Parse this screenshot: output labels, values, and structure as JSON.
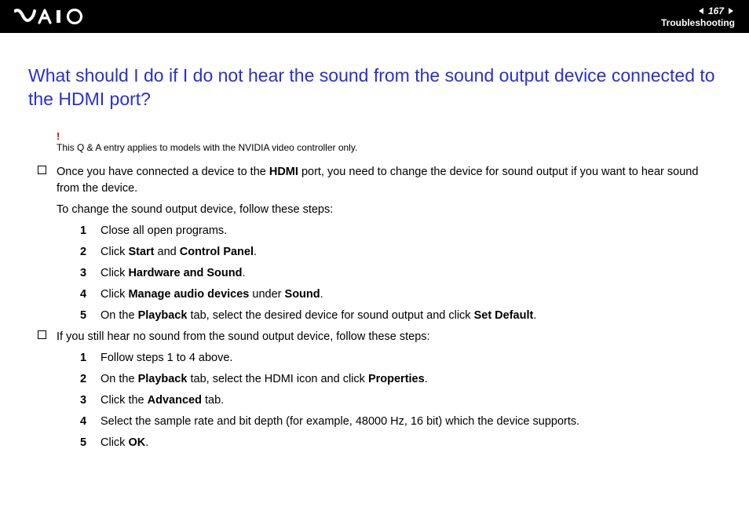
{
  "header": {
    "page_number": "167",
    "section": "Troubleshooting"
  },
  "title": "What should I do if I do not hear the sound from the sound output device connected to the HDMI port?",
  "note": {
    "bang": "!",
    "text": "This Q & A entry applies to models with the NVIDIA video controller only."
  },
  "block1": {
    "intro_a": "Once you have connected a device to the ",
    "intro_b": "HDMI",
    "intro_c": " port, you need to change the device for sound output if you want to hear sound from the device.",
    "lead": "To change the sound output device, follow these steps:",
    "steps": [
      {
        "n": "1",
        "text": "Close all open programs."
      },
      {
        "n": "2",
        "a": "Click ",
        "b1": "Start",
        "mid": " and ",
        "b2": "Control Panel",
        "tail": "."
      },
      {
        "n": "3",
        "a": "Click ",
        "b1": "Hardware and Sound",
        "tail": "."
      },
      {
        "n": "4",
        "a": "Click ",
        "b1": "Manage audio devices",
        "mid": " under ",
        "b2": "Sound",
        "tail": "."
      },
      {
        "n": "5",
        "a": "On the ",
        "b1": "Playback",
        "mid": " tab, select the desired device for sound output and click ",
        "b2": "Set Default",
        "tail": "."
      }
    ]
  },
  "block2": {
    "intro": "If you still hear no sound from the sound output device, follow these steps:",
    "steps": [
      {
        "n": "1",
        "text": "Follow steps 1 to 4 above."
      },
      {
        "n": "2",
        "a": "On the ",
        "b1": "Playback",
        "mid": " tab, select the HDMI icon and click ",
        "b2": "Properties",
        "tail": "."
      },
      {
        "n": "3",
        "a": "Click the ",
        "b1": "Advanced",
        "tail": " tab."
      },
      {
        "n": "4",
        "text": "Select the sample rate and bit depth (for example, 48000 Hz, 16 bit) which the device supports."
      },
      {
        "n": "5",
        "a": "Click ",
        "b1": "OK",
        "tail": "."
      }
    ]
  }
}
